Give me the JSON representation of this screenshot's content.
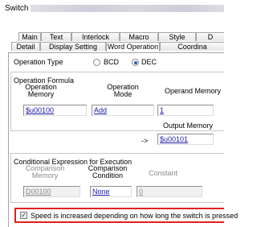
{
  "window": {
    "title": "Switch"
  },
  "tabs": {
    "row1": [
      "Main",
      "Text",
      "Interlock",
      "Macro",
      "Style",
      "D"
    ],
    "row2": [
      "Detail",
      "Display Setting",
      "Word Operation",
      "Coordina"
    ],
    "active": "Word Operation"
  },
  "operation_type": {
    "label": "Operation Type",
    "options": [
      "BCD",
      "DEC"
    ],
    "selected": "DEC"
  },
  "operation_formula": {
    "group_label": "Operation Formula",
    "col_operation_memory": "Operation Memory",
    "col_operation_mode": "Operation Mode",
    "col_operand_memory": "Operand Memory",
    "operation_memory_value": "$u00100",
    "operation_mode_value": "Add",
    "operand_memory_value": "1",
    "output_memory_label": "Output Memory",
    "arrow": "->",
    "output_memory_value": "$u00101"
  },
  "conditional_expression": {
    "group_label": "Conditional Expression for Execution",
    "col_comparison_memory": "Comparison Memory",
    "col_comparison_condition": "Comparison Condition",
    "col_constant": "Constant",
    "comparison_memory_value": "D00100",
    "comparison_condition_value": "None",
    "constant_value": "0"
  },
  "speed_option": {
    "checked": true,
    "label": "Speed is increased depending on how long the switch is pressed"
  },
  "colors": {
    "highlight": "#e02020",
    "link": "#1a1aa8",
    "radio_selected": "#1f5fbf"
  }
}
